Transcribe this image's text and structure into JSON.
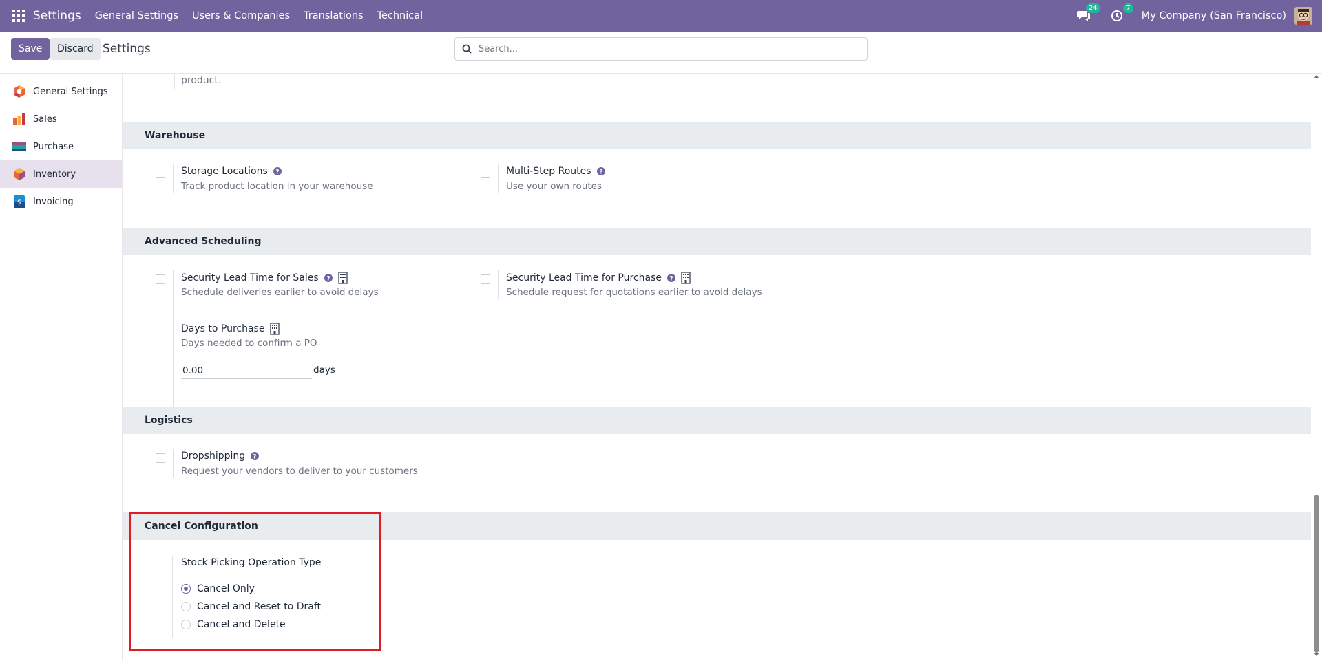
{
  "navbar": {
    "app_title": "Settings",
    "menu": [
      "General Settings",
      "Users & Companies",
      "Translations",
      "Technical"
    ],
    "messages_count": "24",
    "activities_count": "7",
    "company": "My Company (San Francisco)"
  },
  "control": {
    "save_label": "Save",
    "discard_label": "Discard",
    "title": "Settings",
    "search_placeholder": "Search..."
  },
  "sidebar": {
    "items": [
      {
        "label": "General Settings",
        "icon": "general-settings-icon"
      },
      {
        "label": "Sales",
        "icon": "sales-icon"
      },
      {
        "label": "Purchase",
        "icon": "purchase-icon"
      },
      {
        "label": "Inventory",
        "icon": "inventory-icon",
        "active": true
      },
      {
        "label": "Invoicing",
        "icon": "invoicing-icon"
      }
    ]
  },
  "content": {
    "fragment": "product.",
    "warehouse": {
      "header": "Warehouse",
      "storage_title": "Storage Locations",
      "storage_desc": "Track product location in your warehouse",
      "routes_title": "Multi-Step Routes",
      "routes_desc": "Use your own routes"
    },
    "scheduling": {
      "header": "Advanced Scheduling",
      "sales_lead_title": "Security Lead Time for Sales",
      "sales_lead_desc": "Schedule deliveries earlier to avoid delays",
      "purchase_lead_title": "Security Lead Time for Purchase",
      "purchase_lead_desc": "Schedule request for quotations earlier to avoid delays",
      "days_title": "Days to Purchase",
      "days_desc": "Days needed to confirm a PO",
      "days_value": "0.00",
      "days_unit": "days"
    },
    "logistics": {
      "header": "Logistics",
      "drop_title": "Dropshipping",
      "drop_desc": "Request your vendors to deliver to your customers"
    },
    "cancel": {
      "header": "Cancel Configuration",
      "field_label": "Stock Picking Operation Type",
      "options": [
        "Cancel Only",
        "Cancel and Reset to Draft",
        "Cancel and Delete"
      ],
      "selected": "Cancel Only"
    }
  },
  "colors": {
    "brand": "#71639e",
    "badge": "#21b799",
    "highlight": "#e01b24"
  }
}
